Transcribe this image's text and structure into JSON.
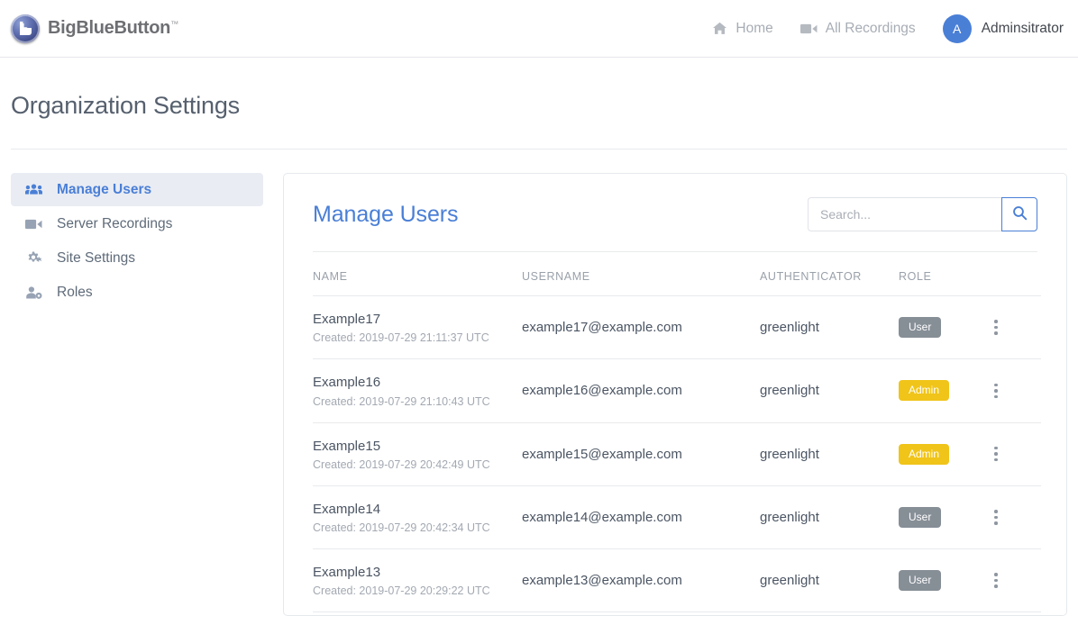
{
  "navbar": {
    "brand": {
      "name": "BigBlueButton",
      "trademark": "™",
      "logo_icon": "bigbluebutton-logo-icon"
    },
    "links": [
      {
        "label": "Home",
        "icon": "home-icon"
      },
      {
        "label": "All Recordings",
        "icon": "video-camera-icon"
      }
    ],
    "user": {
      "initial": "A",
      "name": "Adminsitrator",
      "avatar_color": "#4a7fd6"
    }
  },
  "page": {
    "title": "Organization Settings"
  },
  "sidebar": {
    "items": [
      {
        "label": "Manage Users",
        "icon": "users-icon",
        "active": true
      },
      {
        "label": "Server Recordings",
        "icon": "video-camera-icon",
        "active": false
      },
      {
        "label": "Site Settings",
        "icon": "gears-icon",
        "active": false
      },
      {
        "label": "Roles",
        "icon": "user-tag-icon",
        "active": false
      }
    ]
  },
  "main": {
    "title": "Manage Users",
    "search": {
      "value": "",
      "placeholder": "Search...",
      "button_icon": "search-icon"
    },
    "table": {
      "columns": [
        "NAME",
        "USERNAME",
        "AUTHENTICATOR",
        "ROLE",
        ""
      ],
      "created_prefix": "Created: ",
      "rows": [
        {
          "name": "Example17",
          "created": "Created: 2019-07-29 21:11:37 UTC",
          "username": "example17@example.com",
          "authenticator": "greenlight",
          "role": "User",
          "role_type": "user",
          "actions_icon": "kebab-menu-icon"
        },
        {
          "name": "Example16",
          "created": "Created: 2019-07-29 21:10:43 UTC",
          "username": "example16@example.com",
          "authenticator": "greenlight",
          "role": "Admin",
          "role_type": "admin",
          "actions_icon": "kebab-menu-icon"
        },
        {
          "name": "Example15",
          "created": "Created: 2019-07-29 20:42:49 UTC",
          "username": "example15@example.com",
          "authenticator": "greenlight",
          "role": "Admin",
          "role_type": "admin",
          "actions_icon": "kebab-menu-icon"
        },
        {
          "name": "Example14",
          "created": "Created: 2019-07-29 20:42:34 UTC",
          "username": "example14@example.com",
          "authenticator": "greenlight",
          "role": "User",
          "role_type": "user",
          "actions_icon": "kebab-menu-icon"
        },
        {
          "name": "Example13",
          "created": "Created: 2019-07-29 20:29:22 UTC",
          "username": "example13@example.com",
          "authenticator": "greenlight",
          "role": "User",
          "role_type": "user",
          "actions_icon": "kebab-menu-icon"
        }
      ]
    }
  },
  "colors": {
    "accent_blue": "#4a7fd6",
    "badge_user": "#868e96",
    "badge_admin": "#f0c419",
    "sidebar_active_bg": "#e9ecf3",
    "border": "#e8eaed"
  }
}
